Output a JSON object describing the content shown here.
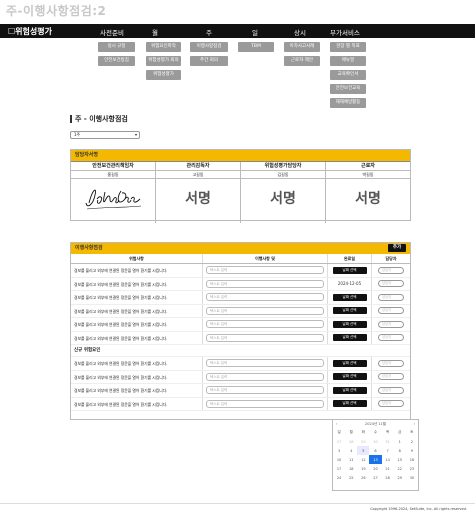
{
  "page_title": "주-이행사항점검:2",
  "nav": {
    "brand": "☐위험성평가",
    "menus": [
      "사전준비",
      "월",
      "주",
      "일",
      "상시",
      "부가서비스"
    ],
    "sub": {
      "prep": [
        "실시 규정",
        "안전보건방침"
      ],
      "month": [
        "위험요인파악",
        "위험성평가 회의",
        "위험성평가"
      ],
      "week": [
        "이행사항점검",
        "주간 회의"
      ],
      "day": [
        "TBM"
      ],
      "always": [
        "아차사고사례",
        "근로자 제안"
      ],
      "extra": [
        "현장 별 목표",
        "매뉴얼",
        "교육확인서",
        "안전보건교육",
        "재해예방활동"
      ]
    }
  },
  "section_title": "주 - 이행사항점검",
  "select_value": "1주",
  "approval": {
    "header": "담당자서명",
    "columns": [
      {
        "role": "안전보건관리책임자",
        "name": "홍길동",
        "sign": ""
      },
      {
        "role": "관리감독자",
        "name": "고길동",
        "sign": "서명"
      },
      {
        "role": "위험성평가담당자",
        "name": "김길동",
        "sign": "서명"
      },
      {
        "role": "근로자",
        "name": "박길동",
        "sign": "서명"
      }
    ],
    "signature_text": "John Doe"
  },
  "hazard": {
    "header": "이행사항점검",
    "add_label": "추가",
    "columns": [
      "위험사항",
      "이행사항 및",
      "완료일",
      "담당자"
    ],
    "rows": [
      {
        "text": "경보를 울리고 외부에 연결된 정문을 열어 환기를 시킵니다.",
        "ph": "텍스트 입력",
        "date": "날짜 선택",
        "mgr": "담당자"
      },
      {
        "text": "경보를 울리고 외부에 연결된 정문을 열어 환기를 시킵니다.",
        "ph": "텍스트 입력",
        "date": "2024-12-05",
        "mgr": "담당자"
      },
      {
        "text": "경보를 울리고 외부에 연결된 정문을 열어 환기를 시킵니다.",
        "ph": "텍스트 입력",
        "date": "날짜 선택",
        "mgr": "담당자"
      },
      {
        "text": "경보를 울리고 외부에 연결된 정문을 열어 환기를 시킵니다.",
        "ph": "텍스트 입력",
        "date": "날짜 선택",
        "mgr": "담당자"
      },
      {
        "text": "경보를 울리고 외부에 연결된 정문을 열어 환기를 시킵니다.",
        "ph": "텍스트 입력",
        "date": "날짜 선택",
        "mgr": "담당자"
      },
      {
        "text": "경보를 울리고 외부에 연결된 정문을 열어 환기를 시킵니다.",
        "ph": "텍스트 입력",
        "date": "날짜 선택",
        "mgr": "담당자"
      }
    ],
    "new_header": "신규 위험요인",
    "new_rows": [
      {
        "text": "경보를 울리고 외부에 연결된 정문을 열어 환기를 시킵니다.",
        "ph": "텍스트 입력",
        "date": "날짜 선택",
        "mgr": "담당자"
      },
      {
        "text": "경보를 울리고 외부에 연결된 정문을 열어 환기를 시킵니다.",
        "ph": "텍스트 입력",
        "date": "날짜 선택",
        "mgr": "담당자"
      },
      {
        "text": "경보를 울리고 외부에 연결된 정문을 열어 환기를 시킵니다.",
        "ph": "텍스트 입력",
        "date": "날짜 선택",
        "mgr": "담당자"
      },
      {
        "text": "경보를 울리고 외부에 연결된 정문을 열어 환기를 시킵니다.",
        "ph": "텍스트 입력",
        "date": "날짜 선택",
        "mgr": "담당자"
      }
    ]
  },
  "calendar": {
    "title": "2024년 11월",
    "weekdays": [
      "일",
      "월",
      "화",
      "수",
      "목",
      "금",
      "토"
    ],
    "weeks": [
      [
        "27",
        "28",
        "29",
        "30",
        "31",
        "1",
        "2"
      ],
      [
        "3",
        "4",
        "5",
        "6",
        "7",
        "8",
        "9"
      ],
      [
        "10",
        "11",
        "12",
        "13",
        "14",
        "15",
        "16"
      ],
      [
        "17",
        "18",
        "19",
        "20",
        "21",
        "22",
        "23"
      ],
      [
        "24",
        "25",
        "26",
        "27",
        "28",
        "29",
        "30"
      ]
    ],
    "selected": "13"
  },
  "copyright": "Copyright 1996-2024, SetSuite, Inc. All rights reserved."
}
